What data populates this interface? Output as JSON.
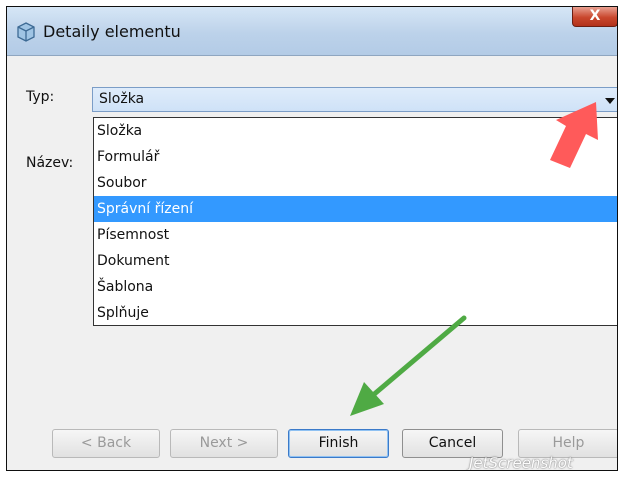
{
  "window": {
    "title": "Detaily elementu",
    "title_icon": "cube-icon",
    "close_label": "X"
  },
  "form": {
    "type_label": "Typ:",
    "name_label": "Název:",
    "type_value": "Složka"
  },
  "dropdown": {
    "options": [
      "Složka",
      "Formulář",
      "Soubor",
      "Správní řízení",
      "Písemnost",
      "Dokument",
      "Šablona",
      "Splňuje"
    ],
    "selected_index": 3
  },
  "buttons": {
    "back": "< Back",
    "next": "Next >",
    "finish": "Finish",
    "cancel": "Cancel",
    "help": "Help"
  },
  "annotations": {
    "red_arrow_color": "#ff5a5a",
    "green_arrow_color": "#4faa44"
  },
  "watermark": "JetScreenshot"
}
